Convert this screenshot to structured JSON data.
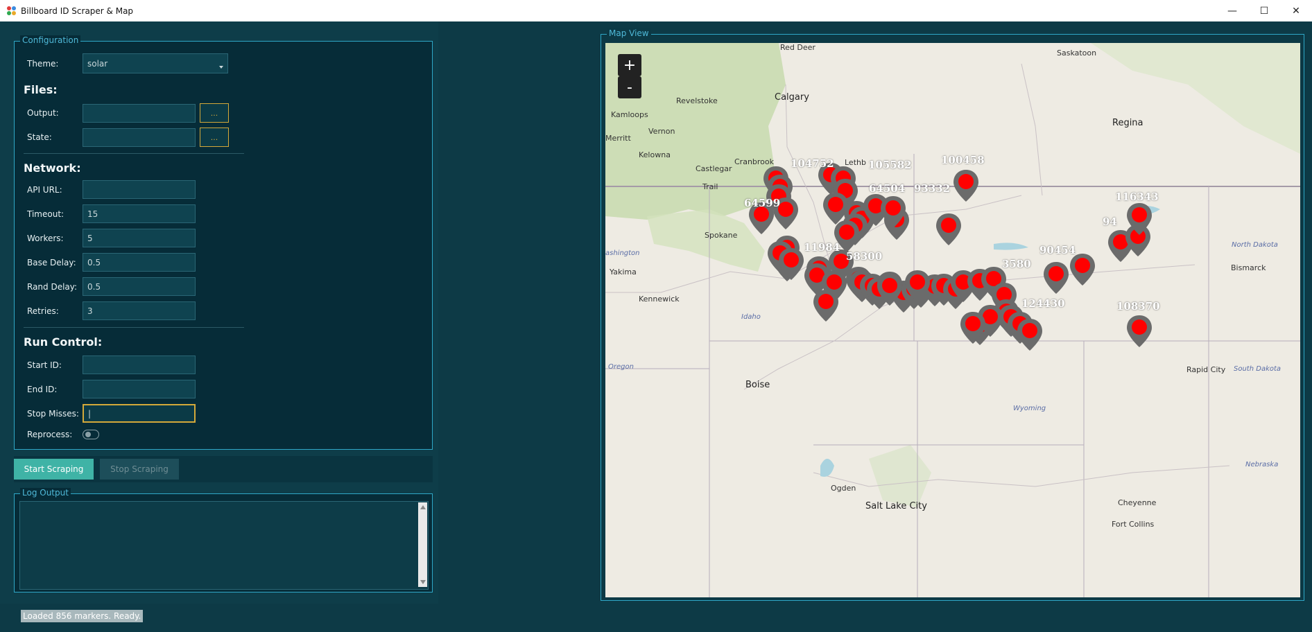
{
  "window": {
    "title": "Billboard ID Scraper & Map",
    "controls": [
      "—",
      "☐",
      "✕"
    ]
  },
  "config": {
    "legend": "Configuration",
    "theme_label": "Theme:",
    "theme_value": "solar",
    "files_heading": "Files:",
    "output_label": "Output:",
    "output_value": "",
    "state_label": "State:",
    "state_value": "",
    "browse_label": "...",
    "network_heading": "Network:",
    "api_url_label": "API URL:",
    "api_url_value": "",
    "timeout_label": "Timeout:",
    "timeout_value": "15",
    "workers_label": "Workers:",
    "workers_value": "5",
    "base_delay_label": "Base Delay:",
    "base_delay_value": "0.5",
    "rand_delay_label": "Rand Delay:",
    "rand_delay_value": "0.5",
    "retries_label": "Retries:",
    "retries_value": "3",
    "run_heading": "Run Control:",
    "start_id_label": "Start ID:",
    "start_id_value": "",
    "end_id_label": "End ID:",
    "end_id_value": "",
    "stop_misses_label": "Stop Misses:",
    "stop_misses_value": "|",
    "reprocess_label": "Reprocess:",
    "reprocess_on": false
  },
  "buttons": {
    "start": "Start Scraping",
    "stop": "Stop Scraping"
  },
  "log": {
    "legend": "Log Output",
    "text": ""
  },
  "status": "Loaded 856 markers. Ready.",
  "map": {
    "legend": "Map View",
    "zoom_in": "+",
    "zoom_out": "-",
    "cities": {
      "red_deer": "Red Deer",
      "saskatoon": "Saskatoon",
      "calgary": "Calgary",
      "revelstoke": "Revelstoke",
      "kamloops": "Kamloops",
      "merritt": "Merritt",
      "vernon": "Vernon",
      "kelowna": "Kelowna",
      "cranbrook": "Cranbrook",
      "castlegar": "Castlegar",
      "trail": "Trail",
      "lethbridge": "Lethb",
      "regina": "Regina",
      "spokane": "Spokane",
      "yakima": "Yakima",
      "kennewick": "Kennewick",
      "bismarck": "Bismarck",
      "boise": "Boise",
      "rapid_city": "Rapid City",
      "ogden": "Ogden",
      "salt_lake": "Salt Lake City",
      "cheyenne": "Cheyenne",
      "fort_collins": "Fort Collins"
    },
    "regions": {
      "washington": "ashington",
      "idaho": "Idaho",
      "oregon": "Oregon",
      "north_dakota": "North Dakota",
      "south_dakota": "South Dakota",
      "wyoming": "Wyoming",
      "nebraska": "Nebraska"
    },
    "marker_labels": {
      "l1": "104752",
      "l2": "64599",
      "l3": "100458",
      "l4": "93332",
      "l5": "64504",
      "l6": "116343",
      "l7": "90454",
      "l8": "108370",
      "l9": "58300",
      "l10": "11984",
      "l11": "3580",
      "l12": "124430",
      "l13": "105582",
      "l14": "94"
    },
    "marker_color": "#ff0000",
    "pin_color": "#6b6b6b"
  }
}
